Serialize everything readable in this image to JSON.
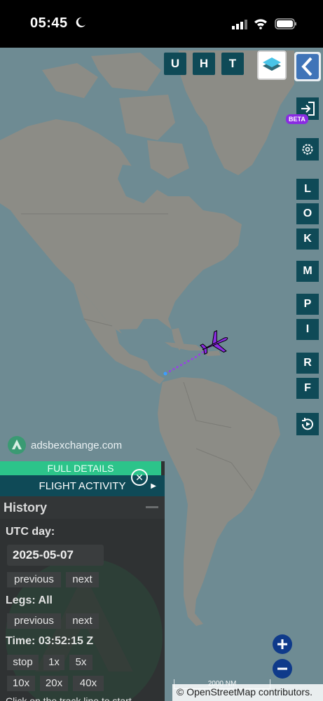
{
  "status": {
    "time": "05:45"
  },
  "top_buttons": [
    "U",
    "H",
    "T"
  ],
  "right_buttons": [
    "L",
    "O",
    "K",
    "M",
    "P",
    "I",
    "R",
    "F"
  ],
  "beta_label": "BETA",
  "brand": "adsbexchange.com",
  "panel": {
    "full_details": "FULL DETAILS",
    "flight_activity": "FLIGHT ACTIVITY",
    "history_title": "History",
    "utc_day_label": "UTC day:",
    "date_value": "2025-05-07",
    "previous": "previous",
    "next": "next",
    "legs_label": "Legs: All",
    "time_label": "Time: 03:52:15 Z",
    "speed_buttons": [
      "stop",
      "1x",
      "5x",
      "10x",
      "20x",
      "40x"
    ],
    "footer_text": "Click on the track line to start"
  },
  "map": {
    "scale_label": "2000 NM",
    "attribution": "© OpenStreetMap contributors.",
    "aircraft_color": "#8a2be2",
    "track_color": "#9b3ee8"
  },
  "icons": [
    "moon-icon",
    "signal-icon",
    "wifi-icon",
    "battery-icon",
    "layers-icon",
    "chevron-left-icon",
    "login-icon",
    "gear-icon",
    "replay-icon",
    "aircraft-icon",
    "close-icon",
    "plus-icon",
    "minus-icon",
    "adsbx-logo-icon"
  ]
}
